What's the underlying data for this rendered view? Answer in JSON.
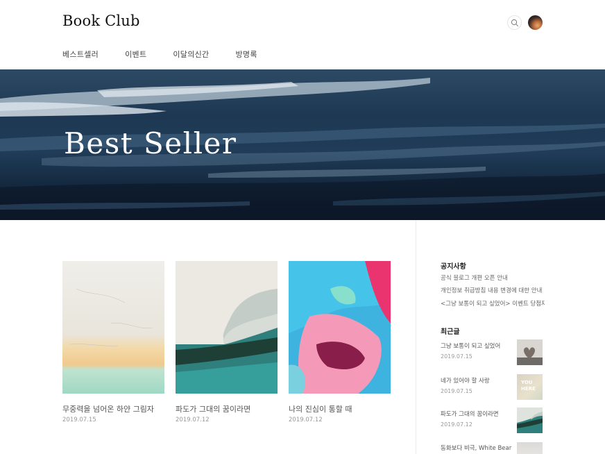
{
  "header": {
    "logo": "Book Club",
    "search_icon": "search-icon",
    "avatar": "avatar"
  },
  "nav": [
    {
      "label": "베스트셀러"
    },
    {
      "label": "이벤트"
    },
    {
      "label": "이달의신간"
    },
    {
      "label": "방명록"
    }
  ],
  "hero": {
    "title": "Best Seller"
  },
  "posts": [
    {
      "title": "무중력을 넘어온 하얀 그림자",
      "date": "2019.07.15"
    },
    {
      "title": "파도가 그대의 꿈이라면",
      "date": "2019.07.12"
    },
    {
      "title": "나의 진심이 통할 때",
      "date": "2019.07.12"
    }
  ],
  "sidebar": {
    "notice_title": "공지사항",
    "notices": [
      "공식 블로그 개편 오픈 안내",
      "개인정보 취급방침 내용 변경에 대한 안내",
      "<그냥 보통이 되고 싶었어> 이벤트 당첨자..."
    ],
    "recent_title": "최근글",
    "recent": [
      {
        "title": "그냥 보통이 되고 싶었어",
        "date": "2019.07.15",
        "thumb_text": ""
      },
      {
        "title": "네가 있어야 할 사랑",
        "date": "2019.07.15",
        "thumb_text": "YOU HERE"
      },
      {
        "title": "파도가 그대의 꿈이라면",
        "date": "2019.07.12",
        "thumb_text": ""
      },
      {
        "title": "동화보다 비극, White Bear",
        "date": "",
        "thumb_text": ""
      }
    ]
  },
  "colors": {
    "hero_navy": "#1e3853",
    "text_dark": "#111111",
    "text_muted": "#999999",
    "divider": "#ececec"
  }
}
